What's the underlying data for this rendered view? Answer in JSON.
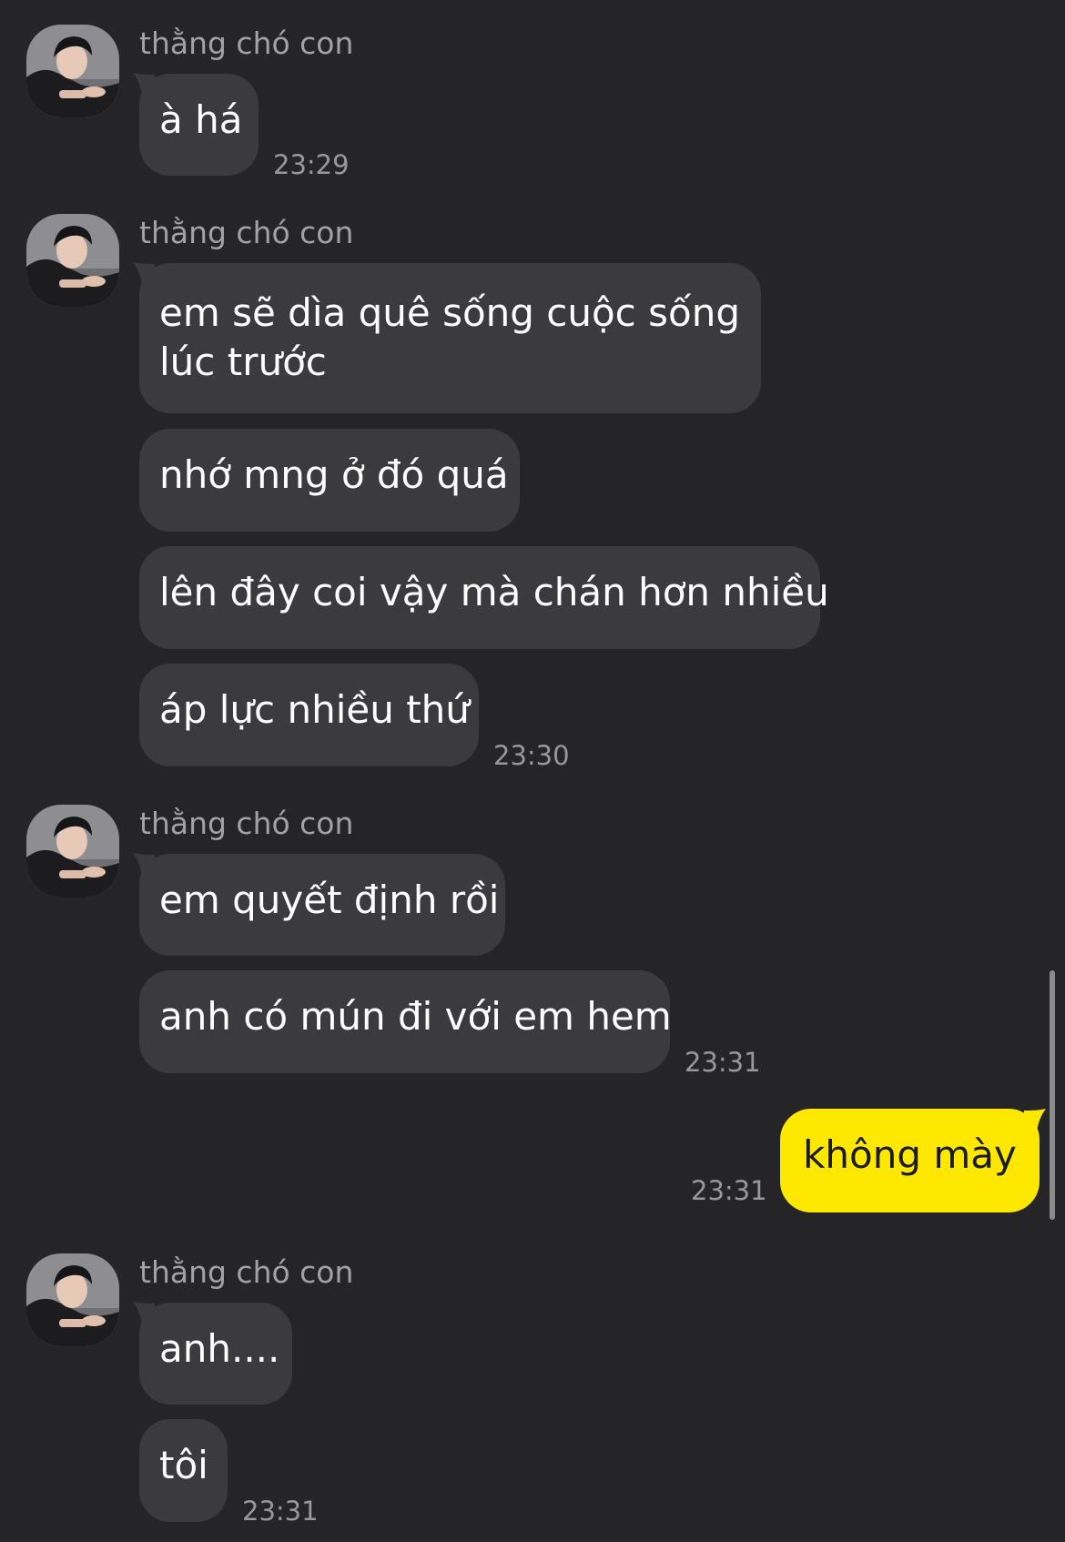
{
  "chat": {
    "groups": [
      {
        "sender": "thằng chó con",
        "avatar_icon": "contact-avatar-photo",
        "messages": [
          "à há"
        ],
        "time": "23:29"
      },
      {
        "sender": "thằng chó con",
        "avatar_icon": "contact-avatar-photo",
        "messages": [
          "em sẽ dìa quê sống cuộc sống lúc trước",
          "nhớ mng ở đó quá",
          "lên đây coi vậy mà chán hơn nhiều",
          "áp lực nhiều thứ"
        ],
        "time": "23:30"
      },
      {
        "sender": "thằng chó con",
        "avatar_icon": "contact-avatar-photo",
        "messages": [
          "em quyết định rồi",
          "anh có mún đi với em hem"
        ],
        "time": "23:31"
      },
      {
        "outgoing": true,
        "messages": [
          "không mày"
        ],
        "time": "23:31"
      },
      {
        "sender": "thằng chó con",
        "avatar_icon": "contact-avatar-photo",
        "messages": [
          "anh....",
          "tôi"
        ],
        "time": "23:31"
      }
    ]
  },
  "colors": {
    "background": "#252527",
    "incoming_bubble": "#3b3b3e",
    "outgoing_bubble": "#ffe800",
    "sender_text": "#a2a2a6",
    "timestamp_text": "#98989c"
  }
}
